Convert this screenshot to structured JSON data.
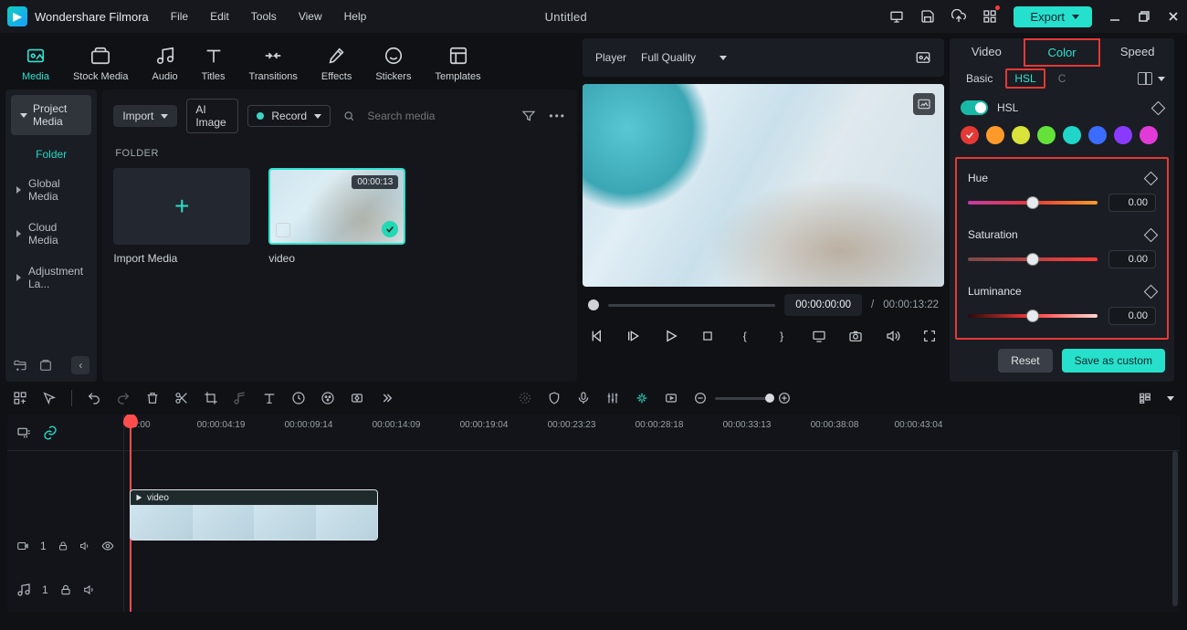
{
  "app": {
    "name": "Wondershare Filmora",
    "title": "Untitled"
  },
  "menus": [
    "File",
    "Edit",
    "Tools",
    "View",
    "Help"
  ],
  "export_label": "Export",
  "tabs": [
    "Media",
    "Stock Media",
    "Audio",
    "Titles",
    "Transitions",
    "Effects",
    "Stickers",
    "Templates"
  ],
  "sidebar": {
    "header": "Project Media",
    "active": "Folder",
    "items": [
      "Global Media",
      "Cloud Media",
      "Adjustment La..."
    ]
  },
  "mid": {
    "import": "Import",
    "ai": "AI Image",
    "record": "Record",
    "search_ph": "Search media",
    "folder": "FOLDER",
    "import_media": "Import Media",
    "clip_dur": "00:00:13",
    "clip_name": "video"
  },
  "preview": {
    "player": "Player",
    "quality": "Full Quality",
    "pos": "00:00:00:00",
    "sep": "/",
    "dur": "00:00:13:22"
  },
  "right": {
    "tabs": [
      "Video",
      "Color",
      "Speed"
    ],
    "subtabs": {
      "basic": "Basic",
      "hsl": "HSL",
      "c": "C"
    },
    "hsl_label": "HSL",
    "colors": [
      "#e53935",
      "#ff9a2a",
      "#d8e23a",
      "#64e23a",
      "#1fd6c8",
      "#3a6cff",
      "#8a3aff",
      "#e23ad8"
    ],
    "hue": {
      "label": "Hue",
      "value": "0.00"
    },
    "sat": {
      "label": "Saturation",
      "value": "0.00"
    },
    "lum": {
      "label": "Luminance",
      "value": "0.00"
    },
    "reset": "Reset",
    "save": "Save as custom"
  },
  "timeline": {
    "ticks": [
      "00:00",
      "00:00:04:19",
      "00:00:09:14",
      "00:00:14:09",
      "00:00:19:04",
      "00:00:23:23",
      "00:00:28:18",
      "00:00:33:13",
      "00:00:38:08",
      "00:00:43:04"
    ],
    "vtrack": "1",
    "atrack": "1",
    "clip": "video"
  }
}
